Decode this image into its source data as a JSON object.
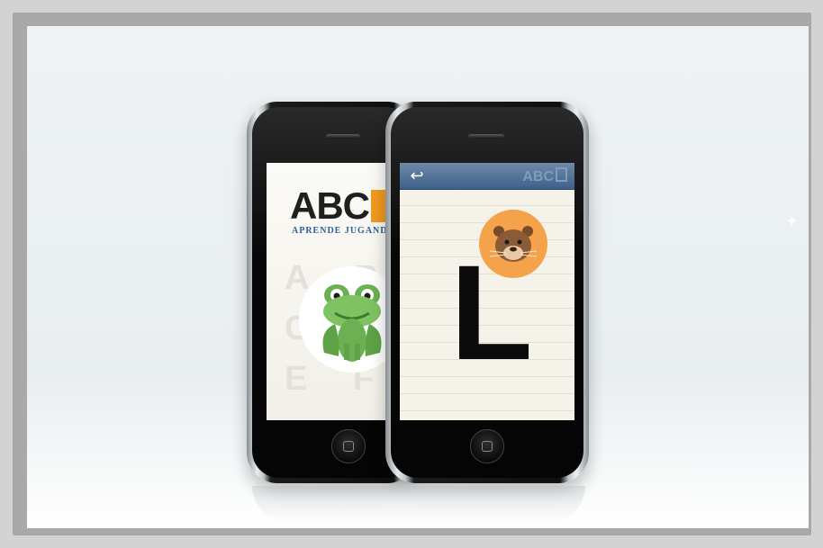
{
  "back_phone": {
    "logo_text": "ABC",
    "tagline": "APRENDE JUGANDO",
    "ghost_letters": "A B C D E F",
    "illustration": "frog-icon"
  },
  "front_phone": {
    "header_title": "ABC",
    "back_button": "undo-arrow-icon",
    "letter": "L",
    "illustration": "otter-icon"
  },
  "colors": {
    "accent_orange": "#f19a1f",
    "header_blue": "#3e6089",
    "frog_green": "#6bb052",
    "otter_disc": "#f4a34b"
  }
}
